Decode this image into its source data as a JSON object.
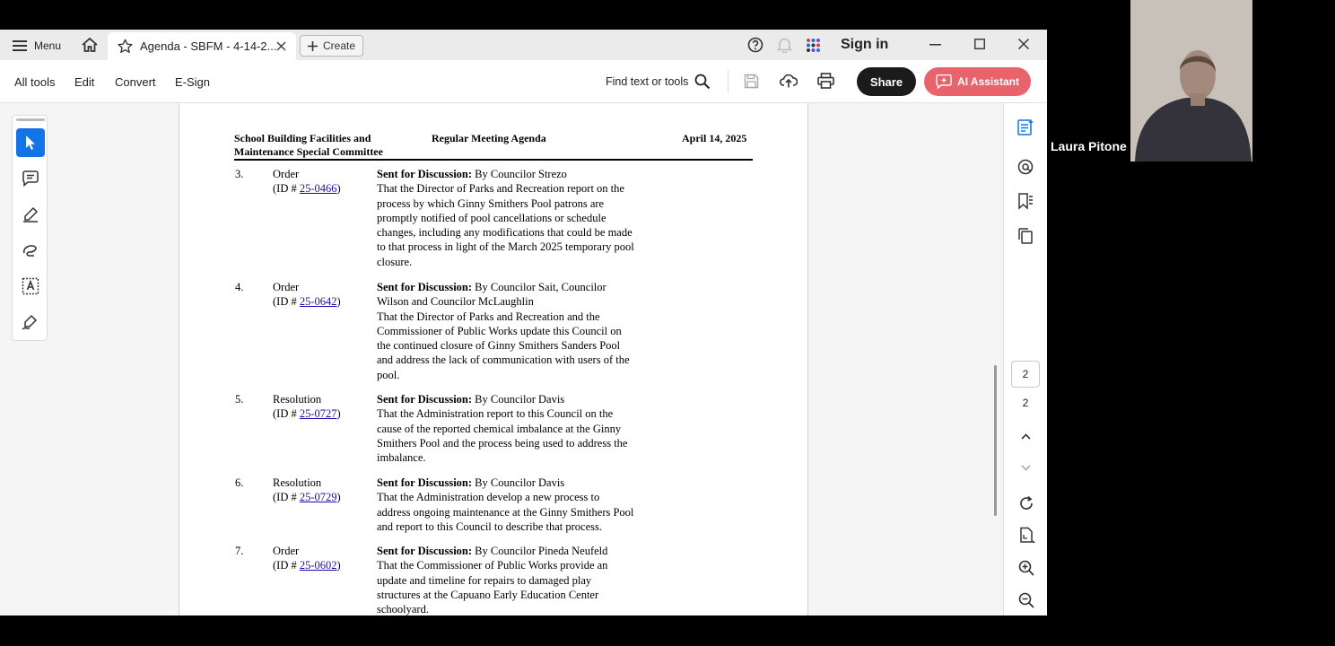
{
  "titlebar": {
    "menu_label": "Menu",
    "tab_title": "Agenda - SBFM - 4-14-2...",
    "create_label": "Create",
    "signin_label": "Sign in"
  },
  "toolbar": {
    "all_tools": "All tools",
    "edit": "Edit",
    "convert": "Convert",
    "esign": "E-Sign",
    "find": "Find text or tools",
    "share": "Share",
    "ai_assistant": "AI Assistant"
  },
  "document": {
    "header_left_1": "School Building Facilities and",
    "header_left_2": "Maintenance Special Committee",
    "header_center": "Regular Meeting Agenda",
    "header_right": "April 14, 2025",
    "items": [
      {
        "num": "3.",
        "type": "Order",
        "id_prefix": "(ID # ",
        "id": "25-0466",
        "id_suffix": ")",
        "sent": "Sent for Discussion:",
        "by": " By Councilor Strezo",
        "lines": [
          "That the Director of Parks and Recreation report on the",
          "process by which Ginny Smithers Pool patrons are",
          "promptly notified of pool cancellations or schedule",
          "changes, including any modifications that could be made",
          "to that process in light of the March 2025 temporary pool",
          "closure."
        ]
      },
      {
        "num": "4.",
        "type": "Order",
        "id_prefix": "(ID # ",
        "id": "25-0642",
        "id_suffix": ")",
        "sent": "Sent for Discussion:",
        "by": " By Councilor Sait, Councilor",
        "lines": [
          "Wilson and Councilor McLaughlin",
          "That the Director of Parks and Recreation and the",
          "Commissioner of Public Works update this Council on",
          "the continued closure of Ginny Smithers Sanders Pool",
          "and address the lack of communication with users of the",
          "pool."
        ]
      },
      {
        "num": "5.",
        "type": "Resolution",
        "id_prefix": "(ID # ",
        "id": "25-0727",
        "id_suffix": ")",
        "sent": "Sent for Discussion:",
        "by": " By Councilor Davis",
        "lines": [
          "That the Administration report to this Council on the",
          "cause of the reported chemical imbalance at the Ginny",
          "Smithers Pool and the process being used to address the",
          "imbalance."
        ]
      },
      {
        "num": "6.",
        "type": "Resolution",
        "id_prefix": "(ID # ",
        "id": "25-0729",
        "id_suffix": ")",
        "sent": "Sent for Discussion:",
        "by": " By Councilor Davis",
        "lines": [
          "That the Administration develop a new process to",
          "address ongoing maintenance at the Ginny Smithers Pool",
          "and report to this Council to describe that process."
        ]
      },
      {
        "num": "7.",
        "type": "Order",
        "id_prefix": "(ID # ",
        "id": "25-0602",
        "id_suffix": ")",
        "sent": "Sent for Discussion:",
        "by": " By Councilor Pineda Neufeld",
        "lines": [
          "That the Commissioner of Public Works provide an",
          "update and timeline for repairs to damaged play",
          "structures at the Capuano Early Education Center",
          "schoolyard."
        ]
      }
    ]
  },
  "page_nav": {
    "current": "2",
    "total": "2"
  },
  "video": {
    "participant_name": "Laura Pitone"
  },
  "colors": {
    "accent_blue": "#1473e6",
    "ai_button": "#e9636d",
    "share_button": "#1b1b1b",
    "link": "#1a0dab"
  }
}
